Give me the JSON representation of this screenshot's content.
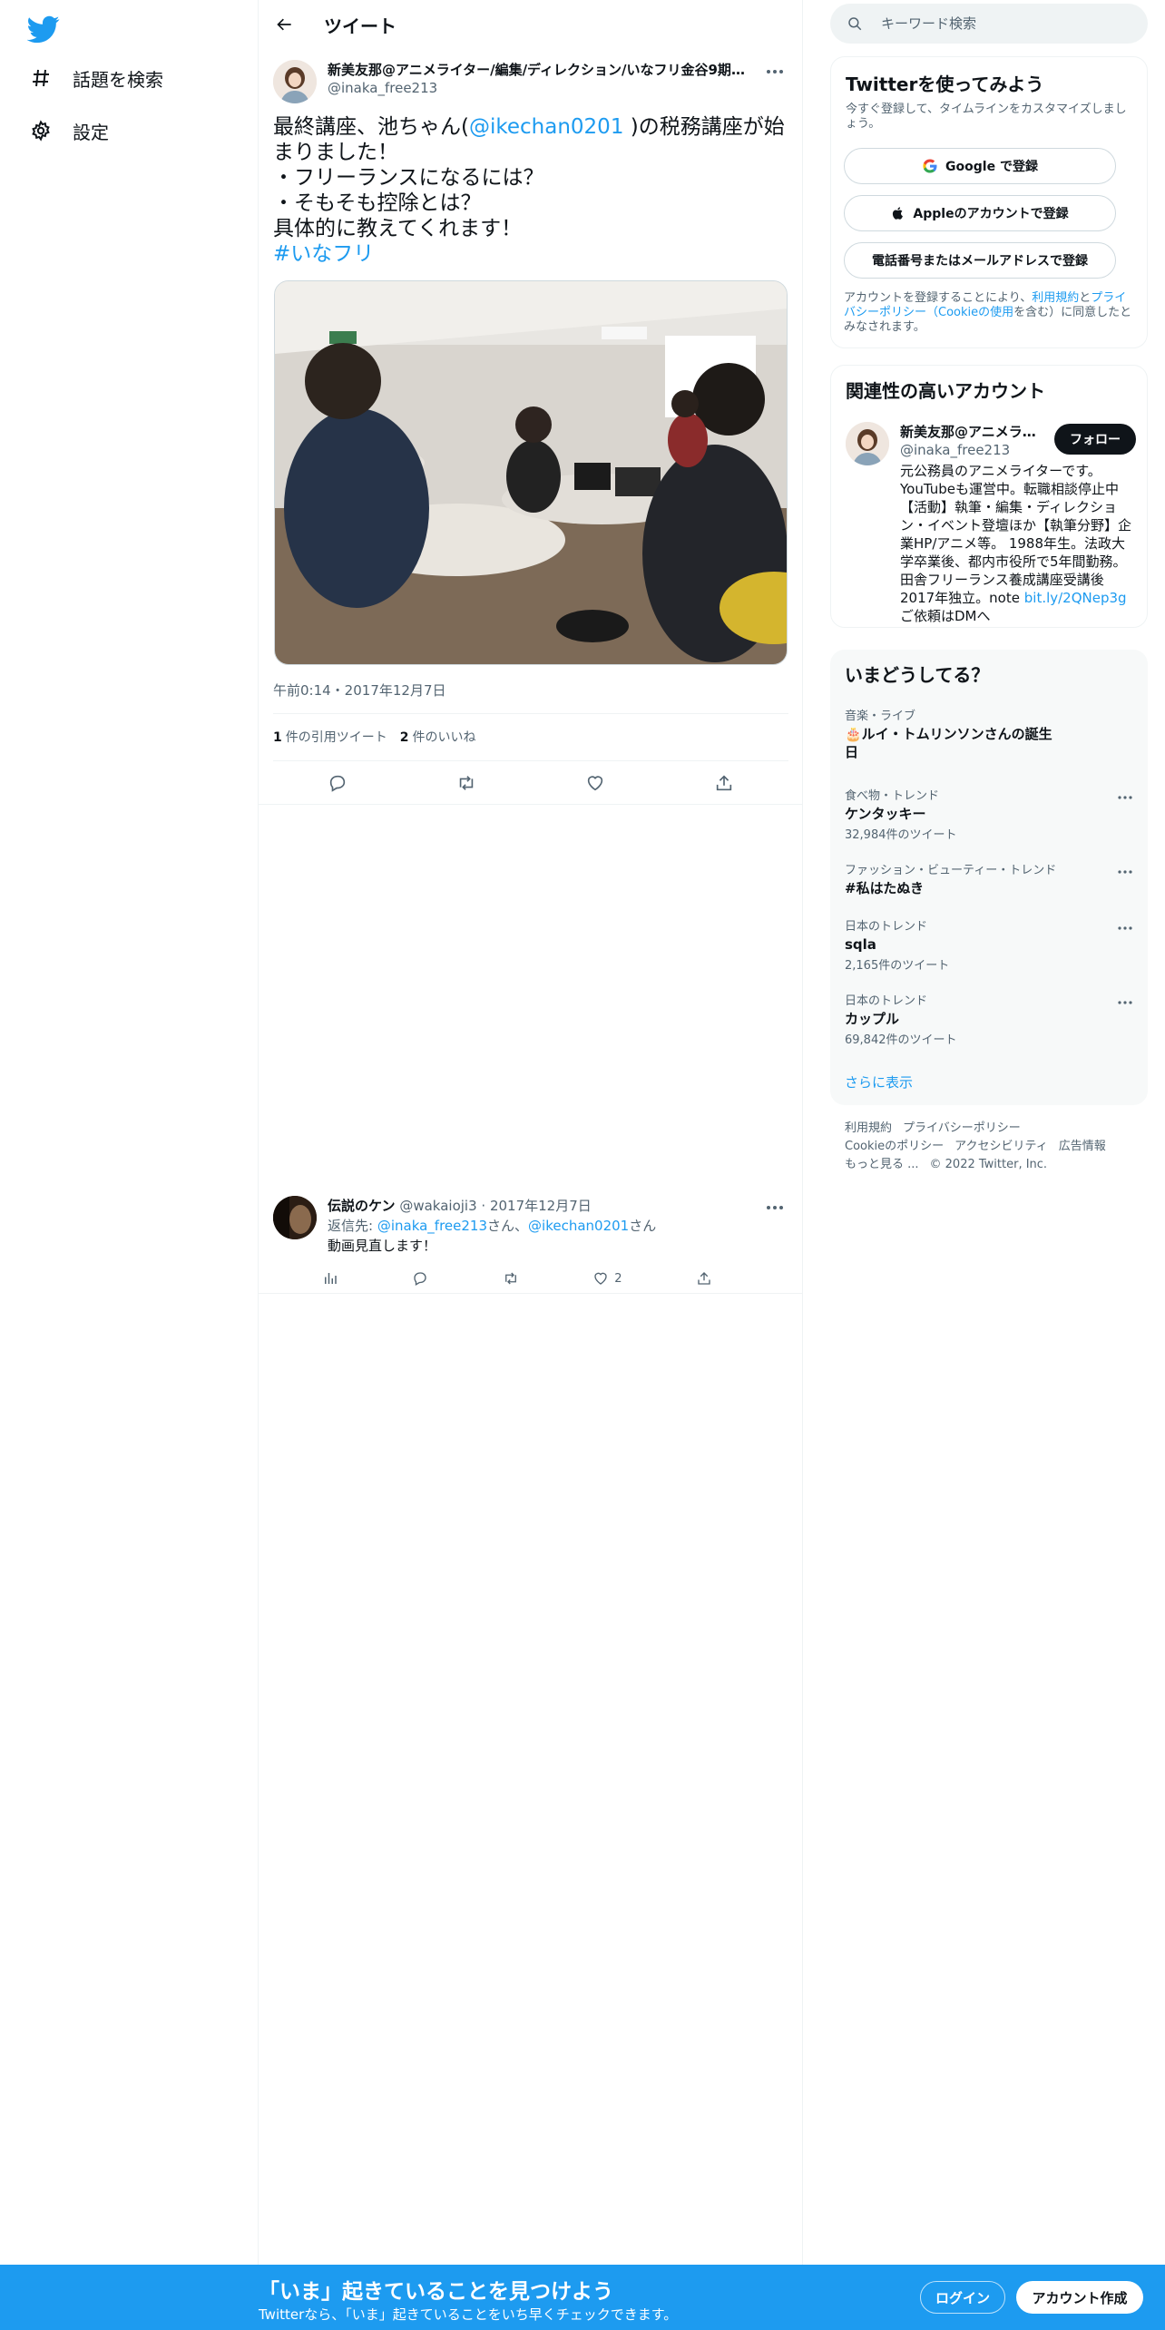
{
  "nav": {
    "logo_icon": "twitter-bird-icon",
    "items": [
      {
        "label": "話題を検索",
        "icon": "hashtag-icon"
      },
      {
        "label": "設定",
        "icon": "gear-icon"
      }
    ]
  },
  "header": {
    "title": "ツイート"
  },
  "tweet": {
    "author_name": "新美友那@アニメライター/編集/ディレクション/いなフリ金谷9期/...",
    "author_handle": "@inaka_free213",
    "text": {
      "line1_pre": "最終講座、池ちゃん(",
      "line1_mention": "@ikechan0201",
      "line1_post": " )の税務講座が始",
      "line2": "まりました！",
      "line3": "・フリーランスになるには？",
      "line4": "・そもそも控除とは？",
      "line5": "具体的に教えてくれます！",
      "hashtag": "#いなフリ"
    },
    "timestamp": "午前0:14・2017年12月7日",
    "quote_count": "1",
    "quote_label": "件の引用ツイート",
    "like_count": "2",
    "like_label": "件のいいね"
  },
  "reply": {
    "name": "伝説のケン",
    "handle_date": "@wakaioji3 · 2017年12月7日",
    "reply_prefix": "返信先: ",
    "mention1": "@inaka_free213",
    "san1": "さん、",
    "mention2": "@ikechan0201",
    "san2": "さん",
    "text": "動画見直します！",
    "like_count": "2"
  },
  "search": {
    "placeholder": "キーワード検索"
  },
  "signup": {
    "title": "Twitterを使ってみよう",
    "subtitle": "今すぐ登録して、タイムラインをカスタマイズしましょう。",
    "google": "Google で登録",
    "apple": "Appleのアカウントで登録",
    "phone": "電話番号またはメールアドレスで登録",
    "legal_pre": "アカウントを登録することにより、",
    "legal_terms": "利用規約",
    "legal_and": "と",
    "legal_privacy": "プライバシーポリシー（Cookieの使用",
    "legal_post": "を含む）に同意したとみなされます。"
  },
  "related": {
    "title": "関連性の高いアカウント",
    "name": "新美友那@アニメライター/編集",
    "handle": "@inaka_free213",
    "follow": "フォロー",
    "bio_pre": "元公務員のアニメライターです。YouTubeも運営中。転職相談停止中【活動】執筆・編集・ディレクション・イベント登壇ほか【執筆分野】企業HP/アニメ等。 1988年生。法政大学卒業後、都内市役所で5年間勤務。田舎フリーランス養成講座受講後2017年独立。note ",
    "bio_link": "bit.ly/2QNep3g",
    "bio_post": "ご依頼はDMへ"
  },
  "trends": {
    "title": "いまどうしてる？",
    "items": [
      {
        "category": "音楽・ライブ",
        "name": "🎂ルイ・トムリンソンさんの誕生日",
        "count": ""
      },
      {
        "category": "食べ物・トレンド",
        "name": "ケンタッキー",
        "count": "32,984件のツイート"
      },
      {
        "category": "ファッション・ビューティー・トレンド",
        "name": "#私はたぬき",
        "count": ""
      },
      {
        "category": "日本のトレンド",
        "name": "sqla",
        "count": "2,165件のツイート"
      },
      {
        "category": "日本のトレンド",
        "name": "カップル",
        "count": "69,842件のツイート"
      }
    ],
    "show_more": "さらに表示"
  },
  "footer": {
    "terms": "利用規約",
    "privacy": "プライバシーポリシー",
    "cookie": "Cookieのポリシー",
    "accessibility": "アクセシビリティ",
    "ads": "広告情報",
    "more": "もっと見る ...",
    "copyright": "© 2022 Twitter, Inc."
  },
  "bottom_bar": {
    "title": "「いま」起きていることを見つけよう",
    "subtitle": "Twitterなら、「いま」起きていることをいち早くチェックできます。",
    "login": "ログイン",
    "signup": "アカウント作成"
  },
  "colors": {
    "accent": "#1d9bf0",
    "text": "#0f1419",
    "secondary": "#536471"
  }
}
